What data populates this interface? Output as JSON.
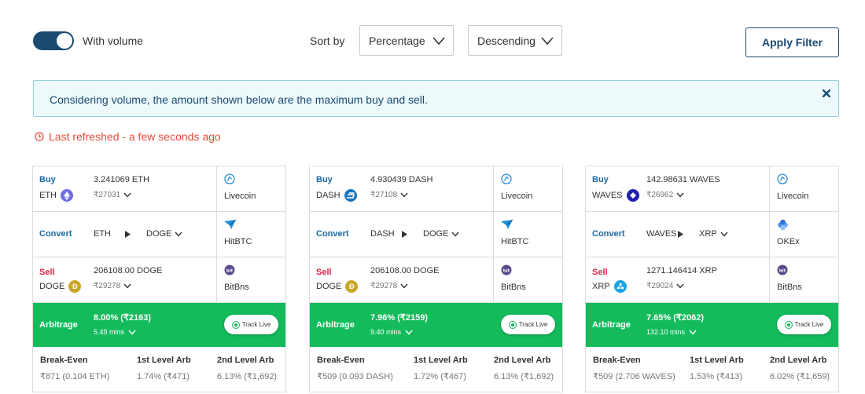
{
  "controls": {
    "toggle_label": "With volume",
    "toggle_on": true,
    "sort_label": "Sort by",
    "sort_field": "Percentage",
    "sort_order": "Descending",
    "apply_label": "Apply Filter"
  },
  "banner": {
    "text": "Considering volume, the amount shown below are the maximum buy and sell.",
    "close_icon": "close-icon"
  },
  "refresh": {
    "text": "Last refreshed - a few seconds ago",
    "icon": "clock-icon"
  },
  "colors": {
    "primary": "#1a4a72",
    "buy_label": "#1a6aa8",
    "sell_label": "#e0224a",
    "arbitrage_bg": "#13bb5b",
    "refresh_text": "#e74c3c",
    "banner_bg": "#edf9fb",
    "banner_border": "#8fd3dc"
  },
  "labels": {
    "buy": "Buy",
    "convert": "Convert",
    "sell": "Sell",
    "arbitrage": "Arbitrage",
    "track_live": "Track Live",
    "break_even": "Break-Even",
    "first_arb": "1st Level Arb",
    "second_arb": "2nd Level Arb"
  },
  "cards": [
    {
      "buy": {
        "coin": "ETH",
        "coin_icon": "ethereum-icon",
        "coin_color": "#6f6fe8",
        "amount": "3.241069 ETH",
        "price": "₹27031",
        "exchange": "Livecoin",
        "exchange_icon": "livecoin-icon"
      },
      "convert": {
        "from": "ETH",
        "to": "DOGE",
        "exchange": "HitBTC",
        "exchange_icon": "hitbtc-icon"
      },
      "sell": {
        "coin": "DOGE",
        "coin_icon": "dogecoin-icon",
        "coin_color": "#c9a628",
        "amount": "206108.00 DOGE",
        "price": "₹29278",
        "exchange": "BitBns",
        "exchange_icon": "bitbns-icon"
      },
      "arbitrage": {
        "percent": "8.00% (₹2163)",
        "time": "5.49 mins"
      },
      "footer": {
        "break_even": "₹871 (0.104 ETH)",
        "first_arb": "1.74% (₹471)",
        "second_arb": "6.13% (₹1,692)"
      }
    },
    {
      "buy": {
        "coin": "DASH",
        "coin_icon": "dash-icon",
        "coin_color": "#1c75bc",
        "amount": "4.930439 DASH",
        "price": "₹27108",
        "exchange": "Livecoin",
        "exchange_icon": "livecoin-icon"
      },
      "convert": {
        "from": "DASH",
        "to": "DOGE",
        "exchange": "HitBTC",
        "exchange_icon": "hitbtc-icon"
      },
      "sell": {
        "coin": "DOGE",
        "coin_icon": "dogecoin-icon",
        "coin_color": "#c9a628",
        "amount": "206108.00 DOGE",
        "price": "₹29278",
        "exchange": "BitBns",
        "exchange_icon": "bitbns-icon"
      },
      "arbitrage": {
        "percent": "7.96% (₹2159)",
        "time": "9.40 mins"
      },
      "footer": {
        "break_even": "₹509 (0.093 DASH)",
        "first_arb": "1.72% (₹467)",
        "second_arb": "6.13% (₹1,692)"
      }
    },
    {
      "buy": {
        "coin": "WAVES",
        "coin_icon": "waves-icon",
        "coin_color": "#1f1fb0",
        "amount": "142.98631 WAVES",
        "price": "₹26962",
        "exchange": "Livecoin",
        "exchange_icon": "livecoin-icon"
      },
      "convert": {
        "from": "WAVES",
        "to": "XRP",
        "exchange": "OKEx",
        "exchange_icon": "okex-icon"
      },
      "sell": {
        "coin": "XRP",
        "coin_icon": "ripple-icon",
        "coin_color": "#1aa3e0",
        "amount": "1271.146414 XRP",
        "price": "₹29024",
        "exchange": "BitBns",
        "exchange_icon": "bitbns-icon"
      },
      "arbitrage": {
        "percent": "7.65% (₹2062)",
        "time": "132.10 mins"
      },
      "footer": {
        "break_even": "₹509 (2.706 WAVES)",
        "first_arb": "1.53% (₹413)",
        "second_arb": "6.02% (₹1,659)"
      }
    }
  ]
}
